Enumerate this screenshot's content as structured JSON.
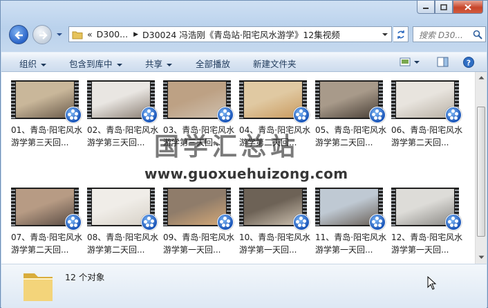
{
  "addressbar": {
    "crumb_overflow": "«",
    "crumb1": "D300...",
    "crumb2": "D30024 冯浩刚《青岛站·阳宅风水游学》12集视频",
    "search_placeholder": "搜索 D30..."
  },
  "toolbar": {
    "organize": "组织",
    "include_in_library": "包含到库中",
    "share": "共享",
    "play_all": "全部播放",
    "new_folder": "新建文件夹"
  },
  "files": [
    {
      "name": "01、青岛·阳宅风水游学第三天回..."
    },
    {
      "name": "02、青岛·阳宅风水游学第三天回..."
    },
    {
      "name": "03、青岛·阳宅风水游学第三天回..."
    },
    {
      "name": "04、青岛·阳宅风水游学第二天回..."
    },
    {
      "name": "05、青岛·阳宅风水游学第二天回..."
    },
    {
      "name": "06、青岛·阳宅风水游学第二天回..."
    },
    {
      "name": "07、青岛·阳宅风水游学第二天回..."
    },
    {
      "name": "08、青岛·阳宅风水游学第二天回..."
    },
    {
      "name": "09、青岛·阳宅风水游学第一天回..."
    },
    {
      "name": "10、青岛·阳宅风水游学第一天回..."
    },
    {
      "name": "11、青岛·阳宅风水游学第一天回..."
    },
    {
      "name": "12、青岛·阳宅风水游学第一天回..."
    }
  ],
  "thumb_colors": [
    [
      "#c9b79a",
      "#6b5b4b"
    ],
    [
      "#e9e6e2",
      "#8d8176"
    ],
    [
      "#bda184",
      "#cfc0ae"
    ],
    [
      "#e0c9a2",
      "#c99a5f"
    ],
    [
      "#a89a8a",
      "#4a4037"
    ],
    [
      "#e8e4de",
      "#b8b0a4"
    ],
    [
      "#b79b84",
      "#5b4d45"
    ],
    [
      "#f0ede8",
      "#d7d1c7"
    ],
    [
      "#8f7c6a",
      "#d4a877"
    ],
    [
      "#6d6256",
      "#cbbfae"
    ],
    [
      "#bfc9d3",
      "#6b625a"
    ],
    [
      "#dddcd8",
      "#8c8a86"
    ]
  ],
  "status": {
    "item_count": "12 个对象"
  },
  "watermark": {
    "title": "国学汇总站",
    "url": "www.guoxuehuizong.com"
  }
}
